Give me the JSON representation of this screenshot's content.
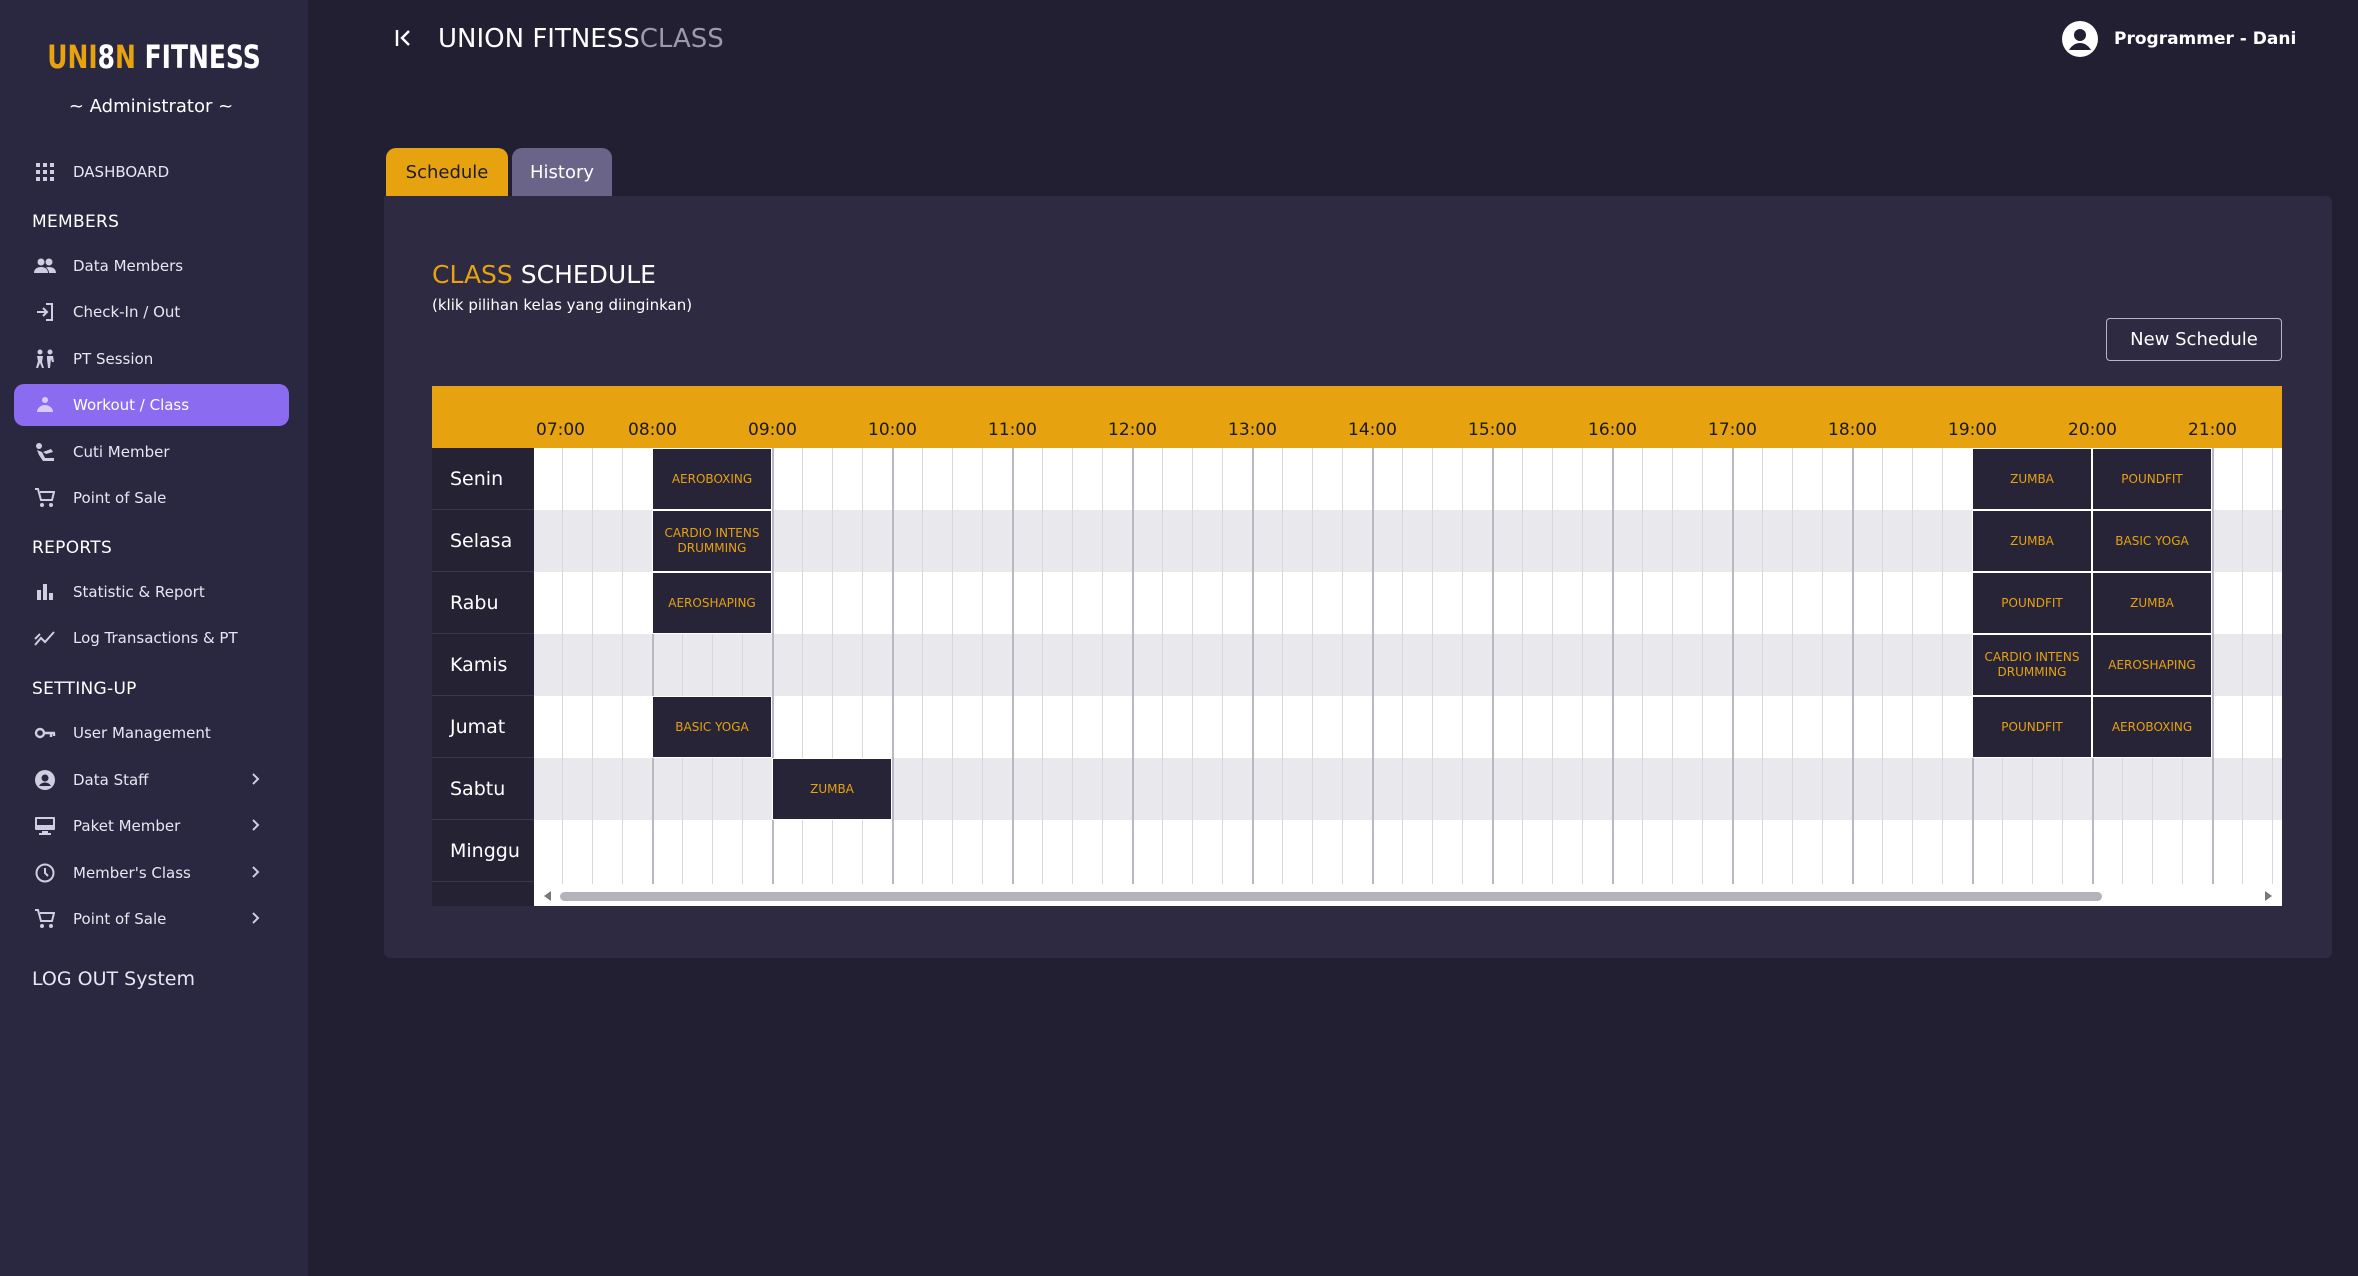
{
  "brand": {
    "logo_part1": "UNI",
    "logo_part2": "8",
    "logo_part3": "N",
    "logo_part4": " FITNESS",
    "role": "~ Administrator ~"
  },
  "sidebar": {
    "dashboard": "DASHBOARD",
    "section_members": "MEMBERS",
    "members": [
      "Data Members",
      "Check-In / Out",
      "PT Session",
      "Workout / Class",
      "Cuti Member",
      "Point of Sale"
    ],
    "section_reports": "REPORTS",
    "reports": [
      "Statistic & Report",
      "Log Transactions & PT"
    ],
    "section_setting": "SETTING-UP",
    "setting": [
      "User Management",
      "Data Staff",
      "Paket Member",
      "Member's Class",
      "Point of Sale"
    ],
    "logout": "LOG OUT System",
    "active_item": "Workout / Class"
  },
  "header": {
    "title_main": "UNION FITNESS",
    "title_sub": "CLASS",
    "user": "Programmer - Dani"
  },
  "tabs": [
    {
      "label": "Schedule",
      "active": true
    },
    {
      "label": "History",
      "active": false
    }
  ],
  "card": {
    "title_accent": "CLASS",
    "title_rest": " SCHEDULE",
    "subtitle": "(klik pilihan kelas yang diinginkan)",
    "new_button": "New Schedule"
  },
  "schedule": {
    "hours": [
      "07:00",
      "08:00",
      "09:00",
      "10:00",
      "11:00",
      "12:00",
      "13:00",
      "14:00",
      "15:00",
      "16:00",
      "17:00",
      "18:00",
      "19:00",
      "20:00",
      "21:00"
    ],
    "days": [
      "Senin",
      "Selasa",
      "Rabu",
      "Kamis",
      "Jumat",
      "Sabtu",
      "Minggu"
    ],
    "classes": [
      {
        "day": "Senin",
        "start": "08:00",
        "end": "09:00",
        "name": "AEROBOXING"
      },
      {
        "day": "Senin",
        "start": "19:00",
        "end": "20:00",
        "name": "ZUMBA"
      },
      {
        "day": "Senin",
        "start": "20:00",
        "end": "21:00",
        "name": "POUNDFIT"
      },
      {
        "day": "Selasa",
        "start": "08:00",
        "end": "09:00",
        "name": "CARDIO INTENS DRUMMING"
      },
      {
        "day": "Selasa",
        "start": "19:00",
        "end": "20:00",
        "name": "ZUMBA"
      },
      {
        "day": "Selasa",
        "start": "20:00",
        "end": "21:00",
        "name": "BASIC YOGA"
      },
      {
        "day": "Rabu",
        "start": "08:00",
        "end": "09:00",
        "name": "AEROSHAPING"
      },
      {
        "day": "Rabu",
        "start": "19:00",
        "end": "20:00",
        "name": "POUNDFIT"
      },
      {
        "day": "Rabu",
        "start": "20:00",
        "end": "21:00",
        "name": "ZUMBA"
      },
      {
        "day": "Kamis",
        "start": "19:00",
        "end": "20:00",
        "name": "CARDIO INTENS DRUMMING"
      },
      {
        "day": "Kamis",
        "start": "20:00",
        "end": "21:00",
        "name": "AEROSHAPING"
      },
      {
        "day": "Jumat",
        "start": "08:00",
        "end": "09:00",
        "name": "BASIC YOGA"
      },
      {
        "day": "Jumat",
        "start": "19:00",
        "end": "20:00",
        "name": "POUNDFIT"
      },
      {
        "day": "Jumat",
        "start": "20:00",
        "end": "21:00",
        "name": "AEROBOXING"
      },
      {
        "day": "Sabtu",
        "start": "09:00",
        "end": "10:00",
        "name": "ZUMBA"
      }
    ]
  },
  "colors": {
    "accent": "#e6a20f",
    "active_nav": "#8b6cf0",
    "sidebar_bg": "#2a2740",
    "page_bg": "#221f33",
    "card_bg": "#2d2a42"
  },
  "icons": [
    "grid-icon",
    "people-icon",
    "login-icon",
    "pt-icon",
    "workout-icon",
    "leave-icon",
    "cart-icon",
    "bar-chart-icon",
    "trend-icon",
    "key-icon",
    "account-icon",
    "monitor-icon",
    "clock-icon",
    "cart-icon",
    "collapse-icon",
    "user-circle-icon",
    "chevron-right-icon"
  ]
}
